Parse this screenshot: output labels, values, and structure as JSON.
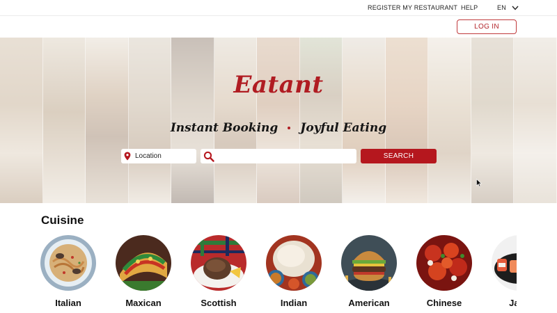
{
  "topbar": {
    "register_label": "REGISTER MY RESTAURANT",
    "help_label": "HELP",
    "language": "EN"
  },
  "header": {
    "login_label": "LOG IN"
  },
  "hero": {
    "brand": "Eatant",
    "tagline_left": "Instant Booking",
    "tagline_right": "Joyful Eating",
    "location_placeholder": "Location",
    "search_placeholder": "",
    "search_button": "SEARCH"
  },
  "cuisine": {
    "title": "Cuisine",
    "items": [
      {
        "label": "Italian"
      },
      {
        "label": "Maxican"
      },
      {
        "label": "Scottish"
      },
      {
        "label": "Indian"
      },
      {
        "label": "American"
      },
      {
        "label": "Chinese"
      },
      {
        "label": "Japa"
      }
    ]
  },
  "colors": {
    "accent": "#b5171e",
    "brand_text": "#b01c22"
  },
  "icons": {
    "location": "location-pin-icon",
    "search": "search-icon",
    "dropdown": "chevron-down-icon"
  }
}
